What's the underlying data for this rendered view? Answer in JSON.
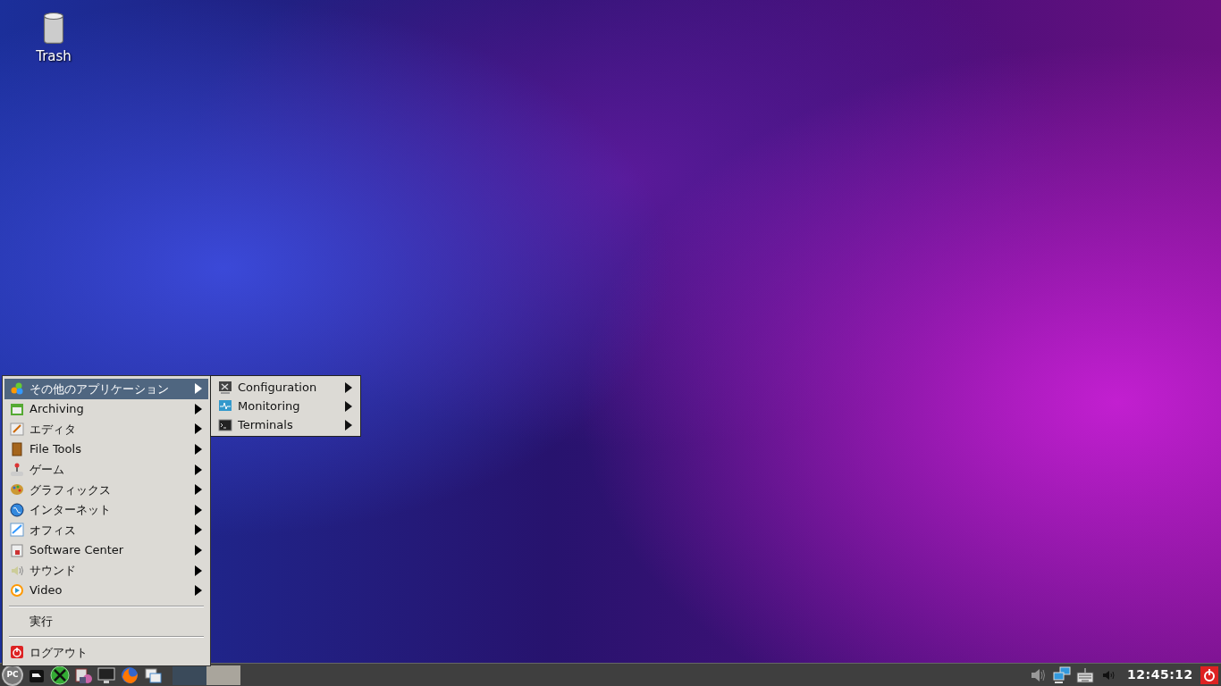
{
  "desktop_icons": [
    {
      "label": "Trash"
    }
  ],
  "menu": {
    "items": [
      {
        "kind": "submenu",
        "label": "その他のアプリケーション",
        "selected": true
      },
      {
        "kind": "submenu",
        "label": "Archiving",
        "selected": false
      },
      {
        "kind": "submenu",
        "label": "エディタ",
        "selected": false
      },
      {
        "kind": "submenu",
        "label": "File Tools",
        "selected": false
      },
      {
        "kind": "submenu",
        "label": "ゲーム",
        "selected": false
      },
      {
        "kind": "submenu",
        "label": "グラフィックス",
        "selected": false
      },
      {
        "kind": "submenu",
        "label": "インターネット",
        "selected": false
      },
      {
        "kind": "submenu",
        "label": "オフィス",
        "selected": false
      },
      {
        "kind": "submenu",
        "label": "Software Center",
        "selected": false
      },
      {
        "kind": "submenu",
        "label": "サウンド",
        "selected": false
      },
      {
        "kind": "submenu",
        "label": "Video",
        "selected": false
      },
      {
        "kind": "separator"
      },
      {
        "kind": "action",
        "label": "実行",
        "selected": false
      },
      {
        "kind": "separator"
      },
      {
        "kind": "action",
        "label": "ログアウト",
        "selected": false
      }
    ]
  },
  "submenu": {
    "items": [
      {
        "kind": "submenu",
        "label": "Configuration"
      },
      {
        "kind": "submenu",
        "label": "Monitoring"
      },
      {
        "kind": "submenu",
        "label": "Terminals"
      }
    ]
  },
  "taskbar": {
    "start_label": "PC",
    "desktops": [
      {
        "selected": true
      },
      {
        "selected": false
      }
    ],
    "clock": "12:45:12"
  }
}
